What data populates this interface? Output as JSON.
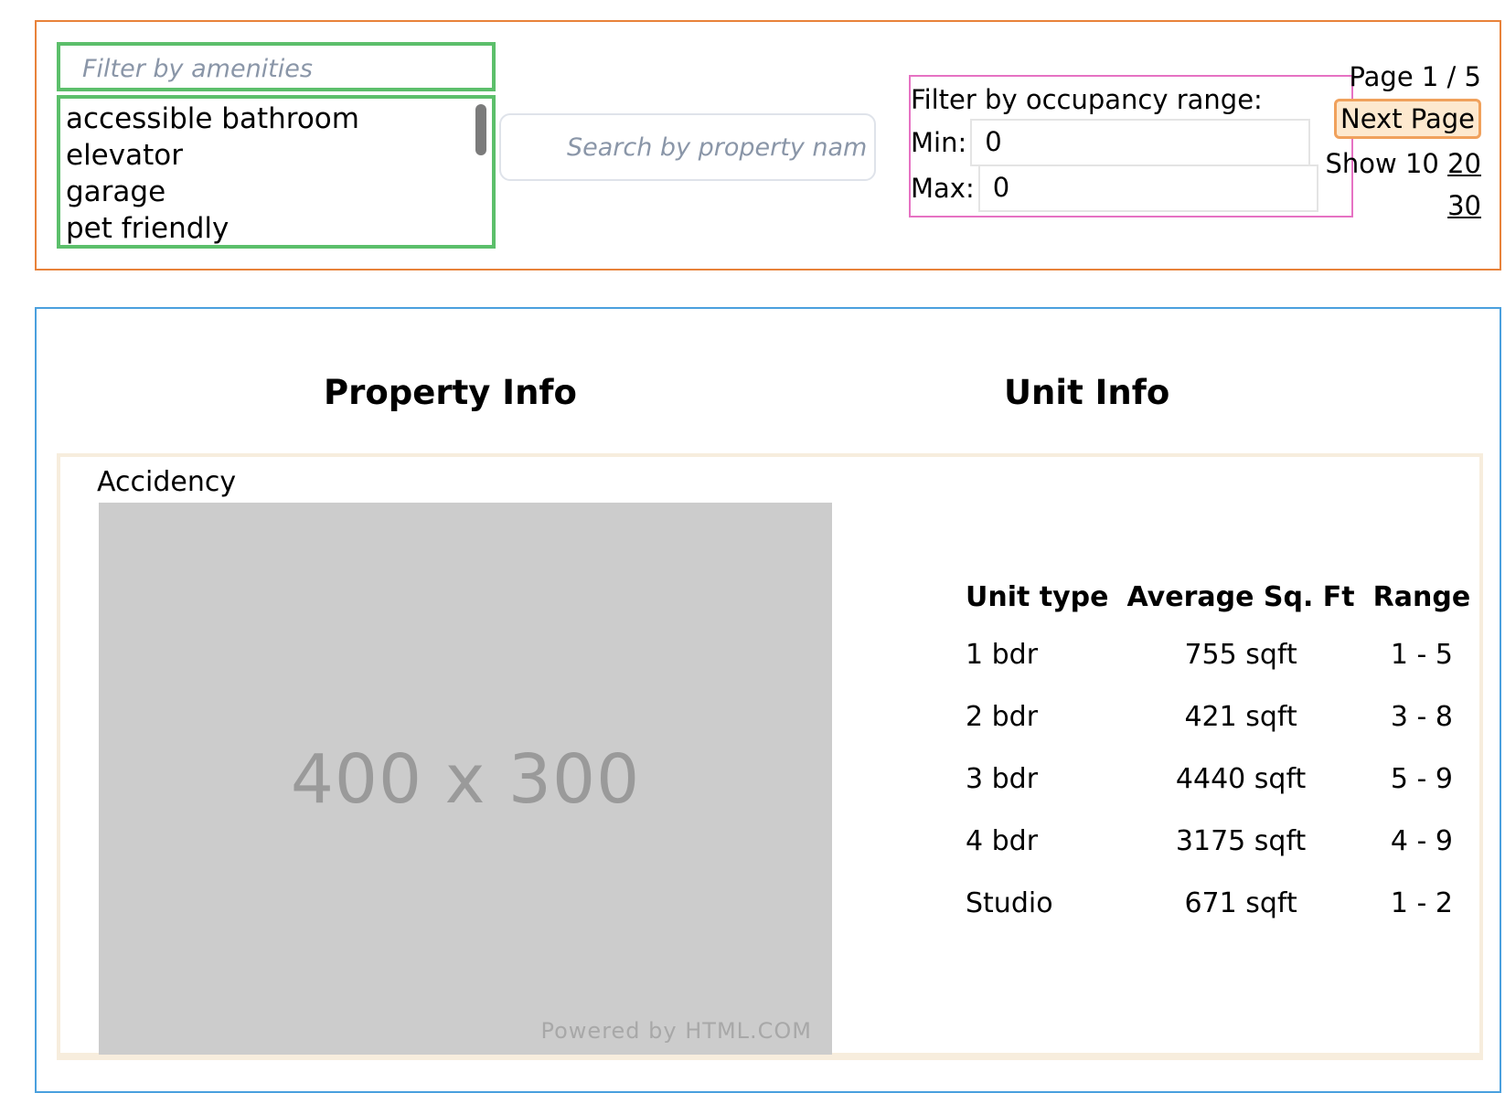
{
  "filters": {
    "amenities": {
      "placeholder": "Filter by amenities",
      "options": [
        "accessible bathroom",
        "elevator",
        "garage",
        "pet friendly"
      ]
    },
    "search": {
      "placeholder": "Search by property nam"
    },
    "occupancy": {
      "title": "Filter by occupancy range:",
      "min_label": "Min:",
      "min_value": "0",
      "max_label": "Max:",
      "max_value": "0"
    },
    "pager": {
      "indicator": "Page 1 / 5",
      "next_label": "Next Page",
      "show_label": "Show",
      "sizes": [
        "10",
        "20",
        "30"
      ]
    }
  },
  "results": {
    "headings": {
      "property": "Property Info",
      "unit": "Unit Info"
    },
    "property": {
      "name": "Accidency",
      "image_size_text": "400 x 300",
      "image_credit": "Powered by HTML.COM"
    },
    "unit_table": {
      "columns": [
        "Unit type",
        "Average Sq. Ft",
        "Range"
      ],
      "rows": [
        [
          "1 bdr",
          "755 sqft",
          "1 - 5"
        ],
        [
          "2 bdr",
          "421 sqft",
          "3 - 8"
        ],
        [
          "3 bdr",
          "4440 sqft",
          "5 - 9"
        ],
        [
          "4 bdr",
          "3175 sqft",
          "4 - 9"
        ],
        [
          "Studio",
          "671 sqft",
          "1 - 2"
        ]
      ]
    }
  },
  "colors": {
    "filter_panel_border": "#e8823a",
    "amenity_border": "#5cbf6b",
    "occupancy_border": "#e672c3",
    "results_panel_border": "#4aa0de",
    "card_border": "#f7eddd",
    "next_button_bg": "#fde9cf"
  }
}
